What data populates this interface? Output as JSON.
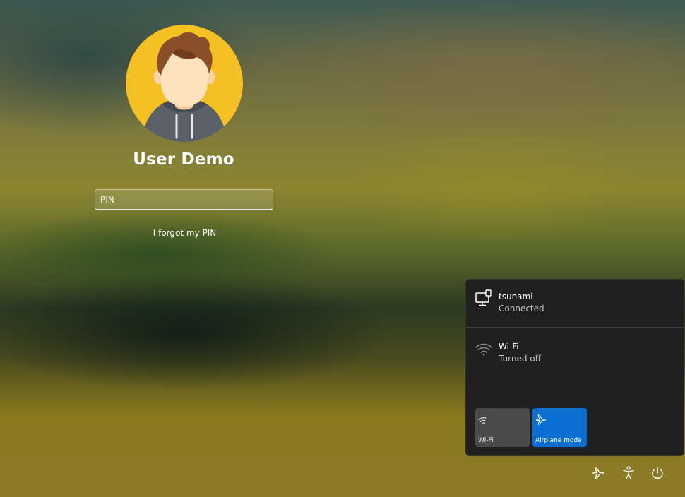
{
  "user": {
    "name": "User Demo"
  },
  "signin": {
    "pin_placeholder": "PIN",
    "forgot_label": "I forgot my PIN"
  },
  "network_flyout": {
    "networks": [
      {
        "name": "tsunami",
        "status": "Connected",
        "icon": "ethernet-computer-icon"
      },
      {
        "name": "Wi-Fi",
        "status": "Turned off",
        "icon": "wifi-icon"
      }
    ],
    "quick_tiles": [
      {
        "label": "Wi-Fi",
        "icon": "wifi-icon",
        "active": false
      },
      {
        "label": "Airplane mode",
        "icon": "airplane-icon",
        "active": true
      }
    ]
  },
  "system_buttons": [
    {
      "icon": "airplane-icon"
    },
    {
      "icon": "accessibility-icon"
    },
    {
      "icon": "power-icon"
    }
  ],
  "colors": {
    "flyout_bg": "#202020",
    "accent_active": "#0a6fd1",
    "tile_inactive": "#4a4a4a",
    "avatar_bg": "#f5c022"
  }
}
